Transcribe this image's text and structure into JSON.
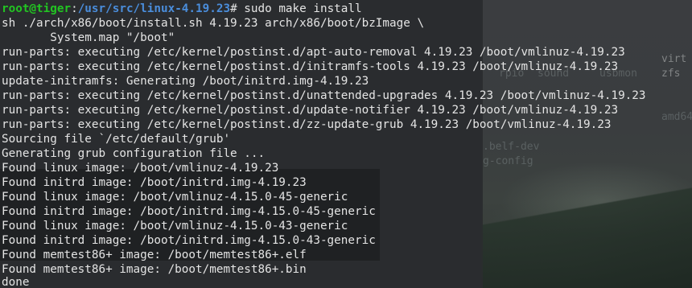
{
  "background_window": {
    "fragments": [
      "virt",
      "zfs",
      "rpio",
      "sound",
      "usbmon",
      "amd64",
      ".belf-dev",
      "g-config"
    ]
  },
  "terminal": {
    "prompt": {
      "user_host": "root@tiger",
      "separator": ":",
      "path": "/usr/src/linux-4.19.23",
      "symbol": "#",
      "command": " sudo make install"
    },
    "output_lines": [
      "sh ./arch/x86/boot/install.sh 4.19.23 arch/x86/boot/bzImage \\",
      "       System.map \"/boot\"",
      "run-parts: executing /etc/kernel/postinst.d/apt-auto-removal 4.19.23 /boot/vmlinuz-4.19.23",
      "run-parts: executing /etc/kernel/postinst.d/initramfs-tools 4.19.23 /boot/vmlinuz-4.19.23",
      "update-initramfs: Generating /boot/initrd.img-4.19.23",
      "run-parts: executing /etc/kernel/postinst.d/unattended-upgrades 4.19.23 /boot/vmlinuz-4.19.23",
      "run-parts: executing /etc/kernel/postinst.d/update-notifier 4.19.23 /boot/vmlinuz-4.19.23",
      "run-parts: executing /etc/kernel/postinst.d/zz-update-grub 4.19.23 /boot/vmlinuz-4.19.23",
      "Sourcing file `/etc/default/grub'",
      "Generating grub configuration file ...",
      "Found linux image: /boot/vmlinuz-4.19.23",
      "Found initrd image: /boot/initrd.img-4.19.23",
      "Found linux image: /boot/vmlinuz-4.15.0-45-generic",
      "Found initrd image: /boot/initrd.img-4.15.0-45-generic",
      "Found linux image: /boot/vmlinuz-4.15.0-43-generic",
      "Found initrd image: /boot/initrd.img-4.15.0-43-generic",
      "Found memtest86+ image: /boot/memtest86+.elf",
      "Found memtest86+ image: /boot/memtest86+.bin",
      "done"
    ]
  },
  "colors": {
    "terminal_bg": "#2b2d2f",
    "text": "#e4e4e4",
    "prompt_user": "#22c422",
    "prompt_path": "#4a8ddb",
    "selection_bg": "#1f2123"
  }
}
